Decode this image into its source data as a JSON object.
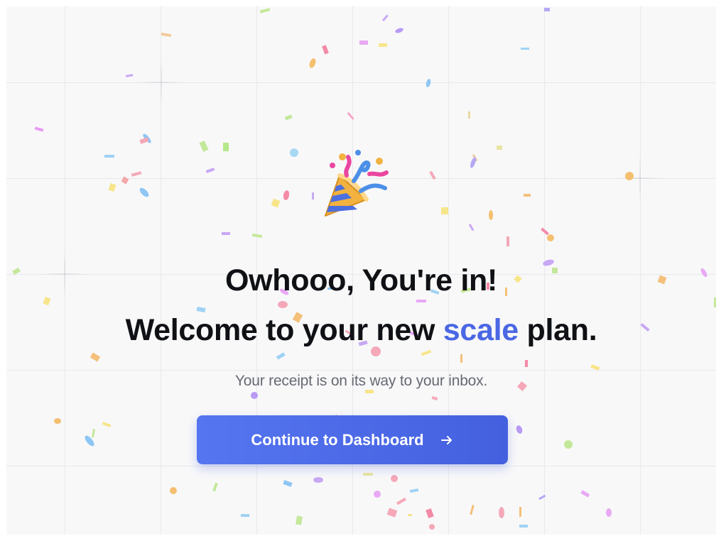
{
  "page": {
    "title_line_1": "Owhooo, You're in!",
    "title_line_2_prefix": "Welcome to your new ",
    "title_line_2_accent": "scale",
    "title_line_2_suffix": " plan.",
    "subtitle": "Your receipt is on its way to your inbox.",
    "cta_label": "Continue to Dashboard",
    "cta_icon": "arrow-right-icon",
    "hero_icon": "party-popper-icon"
  },
  "colors": {
    "accent": "#4a67e4",
    "button": "#4d6ce8",
    "heading": "#0f1115",
    "subtitle": "#666a72",
    "background": "#f8f8f9"
  }
}
